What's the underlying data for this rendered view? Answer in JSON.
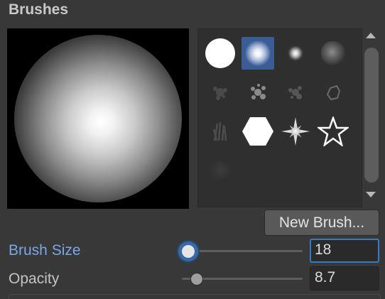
{
  "panel": {
    "title": "Brushes"
  },
  "brush_grid": {
    "items": [
      {
        "name": "hard-round"
      },
      {
        "name": "soft-round",
        "selected": true
      },
      {
        "name": "small-soft"
      },
      {
        "name": "cloud"
      },
      {
        "name": "splatter-1"
      },
      {
        "name": "splatter-2"
      },
      {
        "name": "splatter-3"
      },
      {
        "name": "splatter-4"
      },
      {
        "name": "grass"
      },
      {
        "name": "hexagon"
      },
      {
        "name": "sparkle"
      },
      {
        "name": "star"
      },
      {
        "name": "faint"
      }
    ]
  },
  "buttons": {
    "new_brush": "New Brush..."
  },
  "brush_size": {
    "label": "Brush Size",
    "value": "18",
    "slider_fraction": 0.05
  },
  "opacity": {
    "label": "Opacity",
    "value": "8.7",
    "slider_fraction": 0.12
  },
  "colors": {
    "accent": "#3a79bb",
    "active_label": "#7aa7e6",
    "selected_brush_bg": "#3a5d96"
  }
}
